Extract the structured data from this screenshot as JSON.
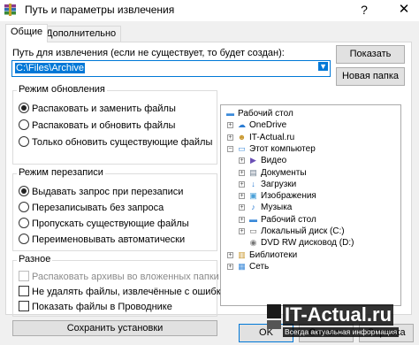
{
  "window": {
    "title": "Путь и параметры извлечения",
    "help_glyph": "?",
    "close_glyph": "✕"
  },
  "tabs": [
    {
      "label": "Общие",
      "active": true
    },
    {
      "label": "Дополнительно",
      "active": false
    }
  ],
  "path": {
    "label": "Путь для извлечения (если не существует, то будет создан):",
    "value": "C:\\Files\\Archive"
  },
  "buttons": {
    "show": "Показать",
    "new_folder": "Новая папка",
    "save_settings": "Сохранить установки",
    "ok": "OK",
    "cancel": "Отмена",
    "help": "Справка"
  },
  "update_mode": {
    "title": "Режим обновления",
    "options": [
      {
        "label": "Распаковать и заменить файлы",
        "selected": true
      },
      {
        "label": "Распаковать и обновить файлы",
        "selected": false
      },
      {
        "label": "Только обновить существующие файлы",
        "selected": false
      }
    ]
  },
  "overwrite_mode": {
    "title": "Режим перезаписи",
    "options": [
      {
        "label": "Выдавать запрос при перезаписи",
        "selected": true
      },
      {
        "label": "Перезаписывать без запроса",
        "selected": false
      },
      {
        "label": "Пропускать существующие файлы",
        "selected": false
      },
      {
        "label": "Переименовывать автоматически",
        "selected": false
      }
    ]
  },
  "misc": {
    "title": "Разное",
    "options": [
      {
        "label": "Распаковать архивы во вложенных папки",
        "checked": false,
        "disabled": true
      },
      {
        "label": "Не удалять файлы, извлечённые с ошибками",
        "checked": false,
        "disabled": false
      },
      {
        "label": "Показать файлы в Проводнике",
        "checked": false,
        "disabled": false
      }
    ]
  },
  "tree": [
    {
      "label": "Рабочий стол",
      "icon": "desktop-icon",
      "level": 0,
      "expander": ""
    },
    {
      "label": "OneDrive",
      "icon": "cloud-icon",
      "level": 1,
      "expander": "+"
    },
    {
      "label": "IT-Actual.ru",
      "icon": "user-icon",
      "level": 1,
      "expander": "+"
    },
    {
      "label": "Этот компьютер",
      "icon": "computer-icon",
      "level": 1,
      "expander": "−"
    },
    {
      "label": "Видео",
      "icon": "video-icon",
      "level": 2,
      "expander": "+"
    },
    {
      "label": "Документы",
      "icon": "documents-icon",
      "level": 2,
      "expander": "+"
    },
    {
      "label": "Загрузки",
      "icon": "downloads-icon",
      "level": 2,
      "expander": "+"
    },
    {
      "label": "Изображения",
      "icon": "pictures-icon",
      "level": 2,
      "expander": "+"
    },
    {
      "label": "Музыка",
      "icon": "music-icon",
      "level": 2,
      "expander": "+"
    },
    {
      "label": "Рабочий стол",
      "icon": "desktop-folder-icon",
      "level": 2,
      "expander": "+"
    },
    {
      "label": "Локальный диск (C:)",
      "icon": "drive-icon",
      "level": 2,
      "expander": "+"
    },
    {
      "label": "DVD RW дисковод (D:)",
      "icon": "dvd-icon",
      "level": 2,
      "expander": ""
    },
    {
      "label": "Библиотеки",
      "icon": "library-icon",
      "level": 1,
      "expander": "+"
    },
    {
      "label": "Сеть",
      "icon": "network-icon",
      "level": 1,
      "expander": "+"
    }
  ],
  "watermark": {
    "title": "IT-Actual.ru",
    "subtitle": "Всегда актуальная информация"
  },
  "colors": {
    "accent": "#0078d7",
    "button_bg": "#e1e1e1",
    "dialog_bg": "#f0f0f0"
  }
}
